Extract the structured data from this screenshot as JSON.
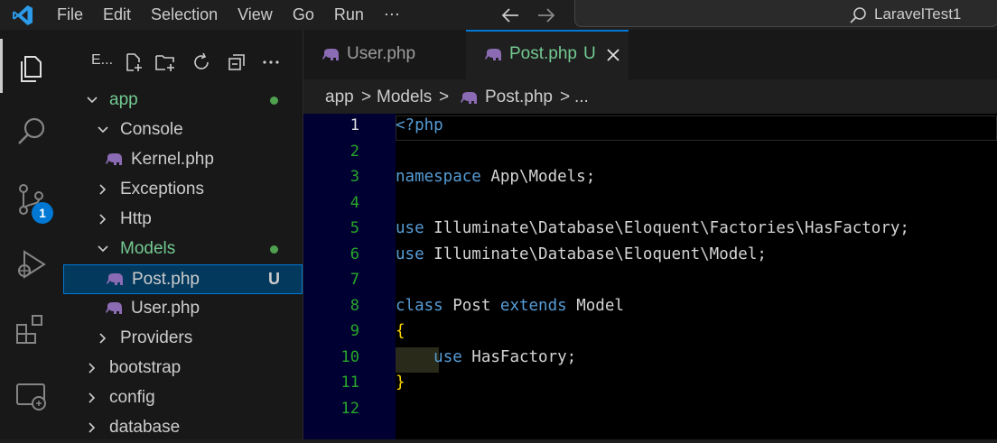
{
  "titlebar": {
    "menu": [
      "File",
      "Edit",
      "Selection",
      "View",
      "Go",
      "Run",
      "⋯"
    ],
    "search": "LaravelTest1"
  },
  "activity": {
    "source_control_badge": "1"
  },
  "sidebar": {
    "title": "E...",
    "tree": [
      {
        "label": "app",
        "chevron": "down",
        "color": "#73c991",
        "dot": true
      },
      {
        "label": "Console",
        "chevron": "down"
      },
      {
        "label": "Kernel.php",
        "file": true
      },
      {
        "label": "Exceptions",
        "chevron": "right"
      },
      {
        "label": "Http",
        "chevron": "right"
      },
      {
        "label": "Models",
        "chevron": "down",
        "color": "#73c991",
        "dot": true
      },
      {
        "label": "Post.php",
        "file": true,
        "selected": true,
        "git": "U"
      },
      {
        "label": "User.php",
        "file": true
      },
      {
        "label": "Providers",
        "chevron": "right"
      },
      {
        "label": "bootstrap",
        "chevron": "right"
      },
      {
        "label": "config",
        "chevron": "right"
      },
      {
        "label": "database",
        "chevron": "right"
      }
    ]
  },
  "tabs": [
    {
      "label": "User.php",
      "active": false
    },
    {
      "label": "Post.php",
      "active": true,
      "git": "U"
    }
  ],
  "breadcrumb": [
    "app",
    ">",
    "Models",
    ">",
    "Post.php",
    ">",
    "..."
  ],
  "editor": {
    "lines": [
      {
        "n": "1",
        "text": "<?php"
      },
      {
        "n": "2",
        "text": ""
      },
      {
        "n": "3",
        "text": "namespace App\\Models;"
      },
      {
        "n": "4",
        "text": ""
      },
      {
        "n": "5",
        "text": "use Illuminate\\Database\\Eloquent\\Factories\\HasFactory;"
      },
      {
        "n": "6",
        "text": "use Illuminate\\Database\\Eloquent\\Model;"
      },
      {
        "n": "7",
        "text": ""
      },
      {
        "n": "8",
        "text": "class Post extends Model"
      },
      {
        "n": "9",
        "text": "{"
      },
      {
        "n": "10",
        "text": "    use HasFactory;"
      },
      {
        "n": "11",
        "text": "}"
      },
      {
        "n": "12",
        "text": ""
      }
    ]
  },
  "colors": {
    "keyword": "#569cd6",
    "brace": "#ffd700",
    "line_number": "#29a829",
    "git_untracked": "#73c991",
    "accent": "#0078d4"
  }
}
